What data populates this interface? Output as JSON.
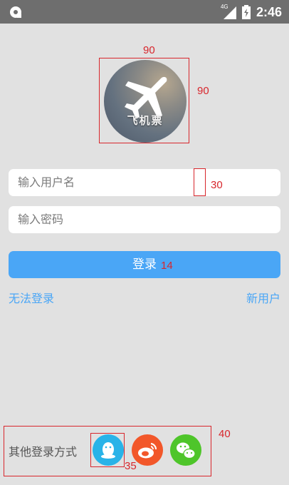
{
  "status_bar": {
    "time": "2:46",
    "network": "4G"
  },
  "avatar": {
    "text": "飞机票",
    "icon": "airplane-icon"
  },
  "annotations": {
    "avatar_width": "90",
    "avatar_height": "90",
    "field_gap": "30",
    "button_font": "14",
    "bottom_height": "40",
    "social_size": "35"
  },
  "form": {
    "username_placeholder": "输入用户名",
    "password_placeholder": "输入密码",
    "login_label": "登录"
  },
  "links": {
    "cant_login": "无法登录",
    "new_user": "新用户"
  },
  "other_login": {
    "label": "其他登录方式",
    "methods": [
      {
        "name": "QQ",
        "icon": "qq-icon",
        "color": "#29b3e8"
      },
      {
        "name": "Weibo",
        "icon": "weibo-icon",
        "color": "#f2572a"
      },
      {
        "name": "WeChat",
        "icon": "wechat-icon",
        "color": "#4ec52a"
      }
    ]
  },
  "colors": {
    "accent": "#4aa6f6",
    "annotation": "#d8262c",
    "background": "#e1e1e1"
  }
}
